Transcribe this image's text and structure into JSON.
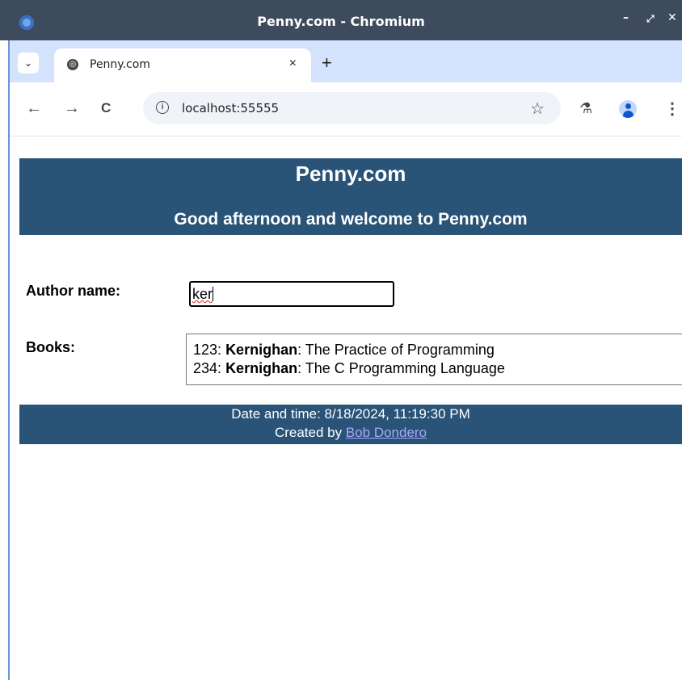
{
  "window": {
    "title": "Penny.com - Chromium",
    "minimize_glyph": "–",
    "restore_glyph": "⤢",
    "close_glyph": "✕"
  },
  "tabs": [
    {
      "label": "Penny.com",
      "close_glyph": "×"
    }
  ],
  "tabstrip": {
    "list_glyph": "⌄",
    "new_tab_glyph": "+"
  },
  "toolbar": {
    "back_glyph": "←",
    "forward_glyph": "→",
    "reload_glyph": "C",
    "info_glyph": "i",
    "url": "localhost:55555",
    "star_glyph": "☆",
    "labs_glyph": "⚗",
    "menu_glyph": "⋮"
  },
  "page": {
    "site_title": "Penny.com",
    "greeting": "Good afternoon and welcome to Penny.com",
    "author_label": "Author name:",
    "author_value": "ker",
    "books_label": "Books:",
    "books": [
      {
        "isbn": "123",
        "author": "Kernighan",
        "title": "The Practice of Programming"
      },
      {
        "isbn": "234",
        "author": "Kernighan",
        "title": "The C Programming Language"
      }
    ],
    "footer": {
      "datetime": "Date and time: 8/18/2024, 11:19:30 PM",
      "created_by": "Created by",
      "creator": "Bob Dondero"
    }
  },
  "colors": {
    "banner": "#295377",
    "titlebar": "#3d4b5d",
    "tabstrip": "#d3e3fd",
    "link": "#a9a7ff"
  }
}
